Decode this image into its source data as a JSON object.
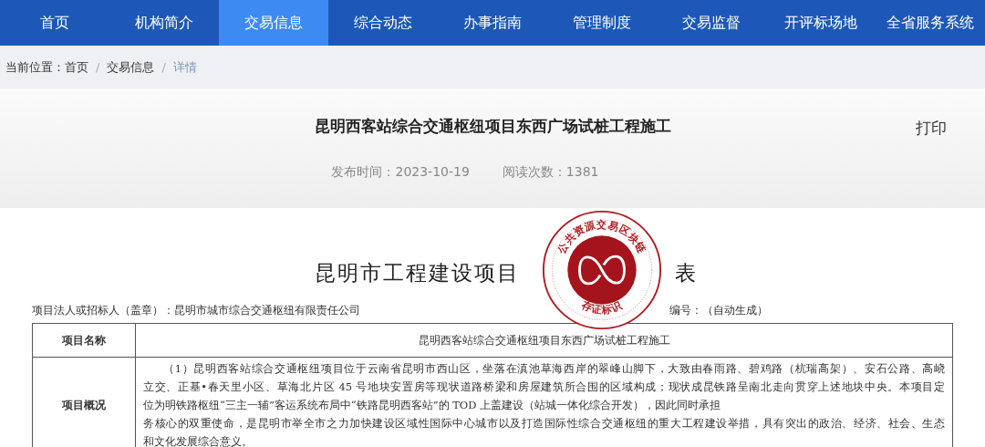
{
  "nav": [
    {
      "label": "首页",
      "selected": false
    },
    {
      "label": "机构简介",
      "selected": false
    },
    {
      "label": "交易信息",
      "selected": true
    },
    {
      "label": "综合动态",
      "selected": false
    },
    {
      "label": "办事指南",
      "selected": false
    },
    {
      "label": "管理制度",
      "selected": false
    },
    {
      "label": "交易监督",
      "selected": false
    },
    {
      "label": "开评标场地",
      "selected": false
    },
    {
      "label": "全省服务系统",
      "selected": false
    }
  ],
  "breadcrumb": {
    "prefix": "当前位置：",
    "separator": "/",
    "items": [
      {
        "label": "首页",
        "current": false
      },
      {
        "label": "交易信息",
        "current": false
      },
      {
        "label": "详情",
        "current": true
      }
    ]
  },
  "article": {
    "title": "昆明西客站综合交通枢纽项目东西广场试桩工程施工",
    "print": "打印",
    "published": "发布时间：2023-10-19",
    "views": "阅读次数：1381"
  },
  "document": {
    "title_before": "昆明市工程建设项目",
    "title_after": "表",
    "seal": {
      "top_text": "公共资源交易区块链",
      "bottom_text": "存证标识"
    },
    "owner": "项目法人或招标人（盖章）：昆明市城市综合交通枢纽有限责任公司",
    "number": "编号：（自动生成）",
    "rows": [
      {
        "label": "项目名称",
        "lines": [
          "昆明西客站综合交通枢纽项目东西广场试桩工程施工"
        ],
        "kind": "single"
      },
      {
        "label": "项目概况",
        "lines": [
          "（1）昆明西客站综合交通枢纽项目位于云南省昆明市西山区，坐落在滇池草海西岸的翠峰山脚下，大致由春雨路、碧鸡路（杭瑞高架）、安石公路、高峣",
          "立交、正基•春天里小区、草海北片区 45 号地块安置房等现状道路桥梁和房屋建筑所合围的区域构成；现状成昆铁路呈南北走向贯穿上述地块中央。本项目定",
          "位为明铁路枢纽“三主一辅”客运系统布局中“铁路昆明西客站”的 TOD 上盖建设（站城一体化综合开发），因此同时承担",
          "务核心的双重使命，是昆明市举全市之力加快建设区域性国际中心城市以及打造国际性综合交通枢纽的重大工程建设举措，具有突出的政治、经济、社会、生态",
          "和文化发展综合意义。"
        ],
        "kind": "paragraph"
      }
    ]
  }
}
